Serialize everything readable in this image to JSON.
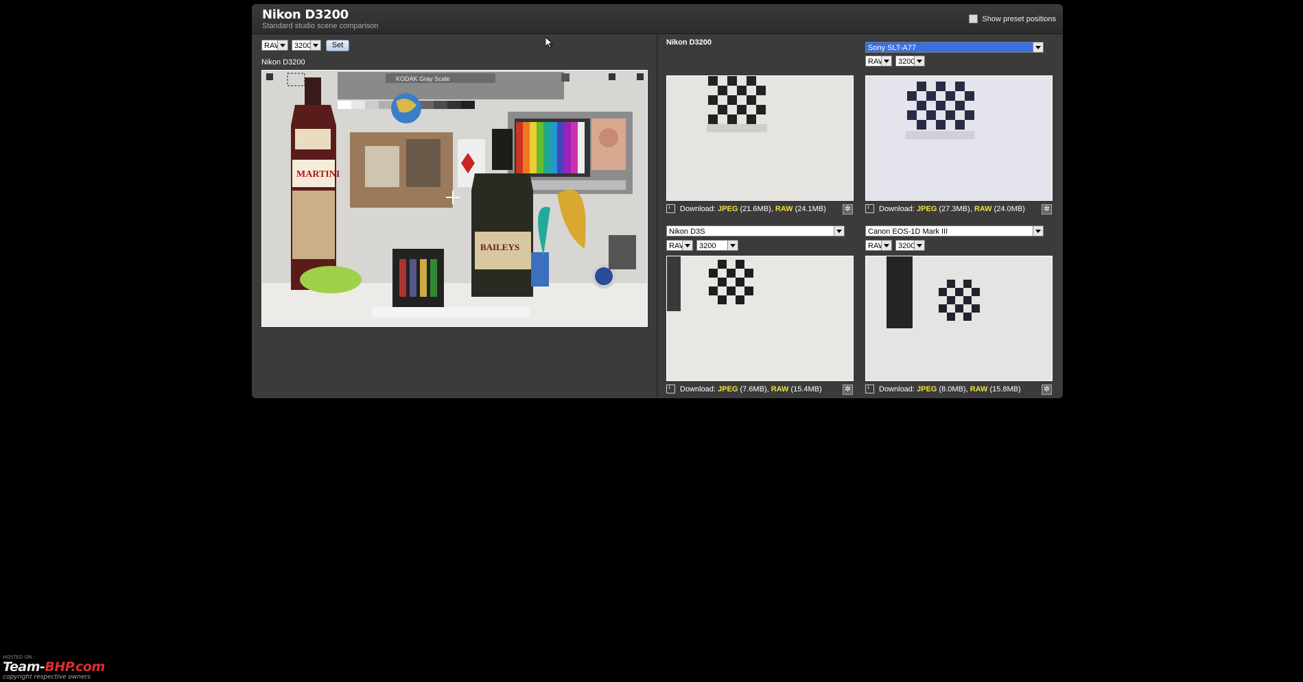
{
  "header": {
    "title": "Nikon D3200",
    "subtitle": "Standard studio scene comparison",
    "preset_label": "Show preset positions"
  },
  "left": {
    "format": "RAW",
    "iso": "3200",
    "set_label": "Set",
    "camera_label": "Nikon D3200",
    "scene_text": {
      "kodak": "KODAK Gray Scale",
      "martini": "MARTINI",
      "baileys": "BAILEYS"
    }
  },
  "panels": [
    {
      "camera": "Nikon D3200",
      "dl_prefix": "Download:",
      "jpeg": "JPEG",
      "jpeg_size": "(21.6MB),",
      "raw": "RAW",
      "raw_size": "(24.1MB)"
    },
    {
      "camera": "Sony SLT-A77",
      "format": "RAW",
      "iso": "3200",
      "dl_prefix": "Download:",
      "jpeg": "JPEG",
      "jpeg_size": "(27.3MB),",
      "raw": "RAW",
      "raw_size": "(24.0MB)"
    },
    {
      "camera": "Nikon D3S",
      "format": "RAW",
      "iso": "3200",
      "dl_prefix": "Download:",
      "jpeg": "JPEG",
      "jpeg_size": "(7.6MB),",
      "raw": "RAW",
      "raw_size": "(15.4MB)"
    },
    {
      "camera": "Canon EOS-1D Mark III",
      "format": "RAW",
      "iso": "3200",
      "dl_prefix": "Download:",
      "jpeg": "JPEG",
      "jpeg_size": "(8.0MB),",
      "raw": "RAW",
      "raw_size": "(15.8MB)"
    }
  ],
  "watermark": {
    "top": "HOSTED ON :",
    "main_a": "Team-",
    "main_b": "BHP",
    "main_c": ".com",
    "sub": "copyright respective owners"
  }
}
